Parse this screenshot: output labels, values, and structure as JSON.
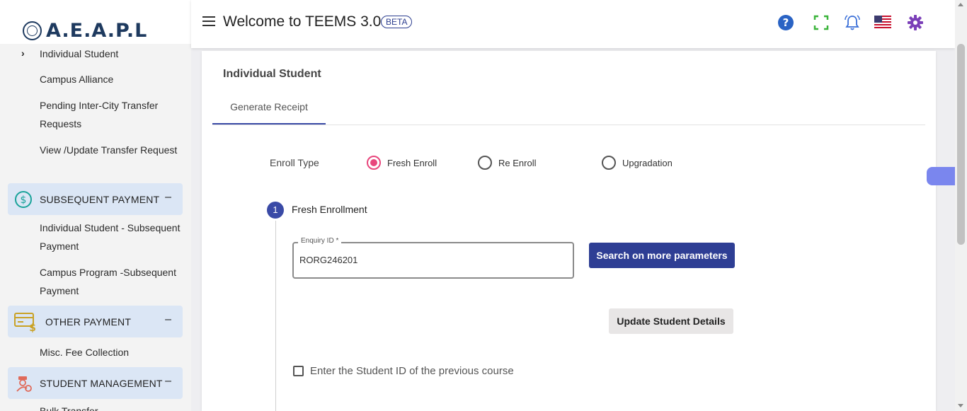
{
  "sidebar": {
    "logo_text": "A.E.A.P.L",
    "items": [
      {
        "label": "Individual Student"
      },
      {
        "label": "Campus Alliance"
      },
      {
        "label": "Pending Inter-City Transfer Requests"
      },
      {
        "label": "View /Update Transfer Request"
      }
    ],
    "sections": [
      {
        "title": "SUBSEQUENT PAYMENT",
        "icon": "dollar-circle-icon",
        "color": "#1aa39a",
        "children": [
          {
            "label": "Individual Student - Subsequent Payment"
          },
          {
            "label": "Campus Program -Subsequent Payment"
          }
        ]
      },
      {
        "title": "OTHER PAYMENT",
        "icon": "card-dollar-icon",
        "color": "#c9a227",
        "children": [
          {
            "label": "Misc. Fee Collection"
          }
        ]
      },
      {
        "title": "STUDENT MANAGEMENT",
        "icon": "student-gear-icon",
        "color": "#e06a5a",
        "children": [
          {
            "label": "Bulk Transfer"
          }
        ]
      }
    ],
    "collapse_symbol": "–"
  },
  "header": {
    "title": "Welcome to TEEMS 3.0",
    "badge": "BETA",
    "icons": [
      "help-icon",
      "fullscreen-icon",
      "notification-bell-icon",
      "us-flag-icon",
      "settings-gear-icon"
    ]
  },
  "main": {
    "title": "Individual Student",
    "tabs": [
      {
        "label": "Generate Receipt",
        "active": true
      }
    ],
    "enroll_type_label": "Enroll Type",
    "enroll_options": [
      {
        "label": "Fresh Enroll",
        "selected": true
      },
      {
        "label": "Re Enroll",
        "selected": false
      },
      {
        "label": "Upgradation",
        "selected": false
      }
    ],
    "step": {
      "number": "1",
      "label": "Fresh Enrollment"
    },
    "enquiry_field": {
      "label": "Enquiry ID *",
      "value": "RORG246201"
    },
    "search_button": "Search on more parameters",
    "update_button": "Update Student Details",
    "checkbox_label": "Enter the Student ID of the previous course"
  },
  "colors": {
    "primary": "#2e3e94",
    "accent_radio": "#e8467c",
    "section_bg": "#dbe6f5"
  }
}
